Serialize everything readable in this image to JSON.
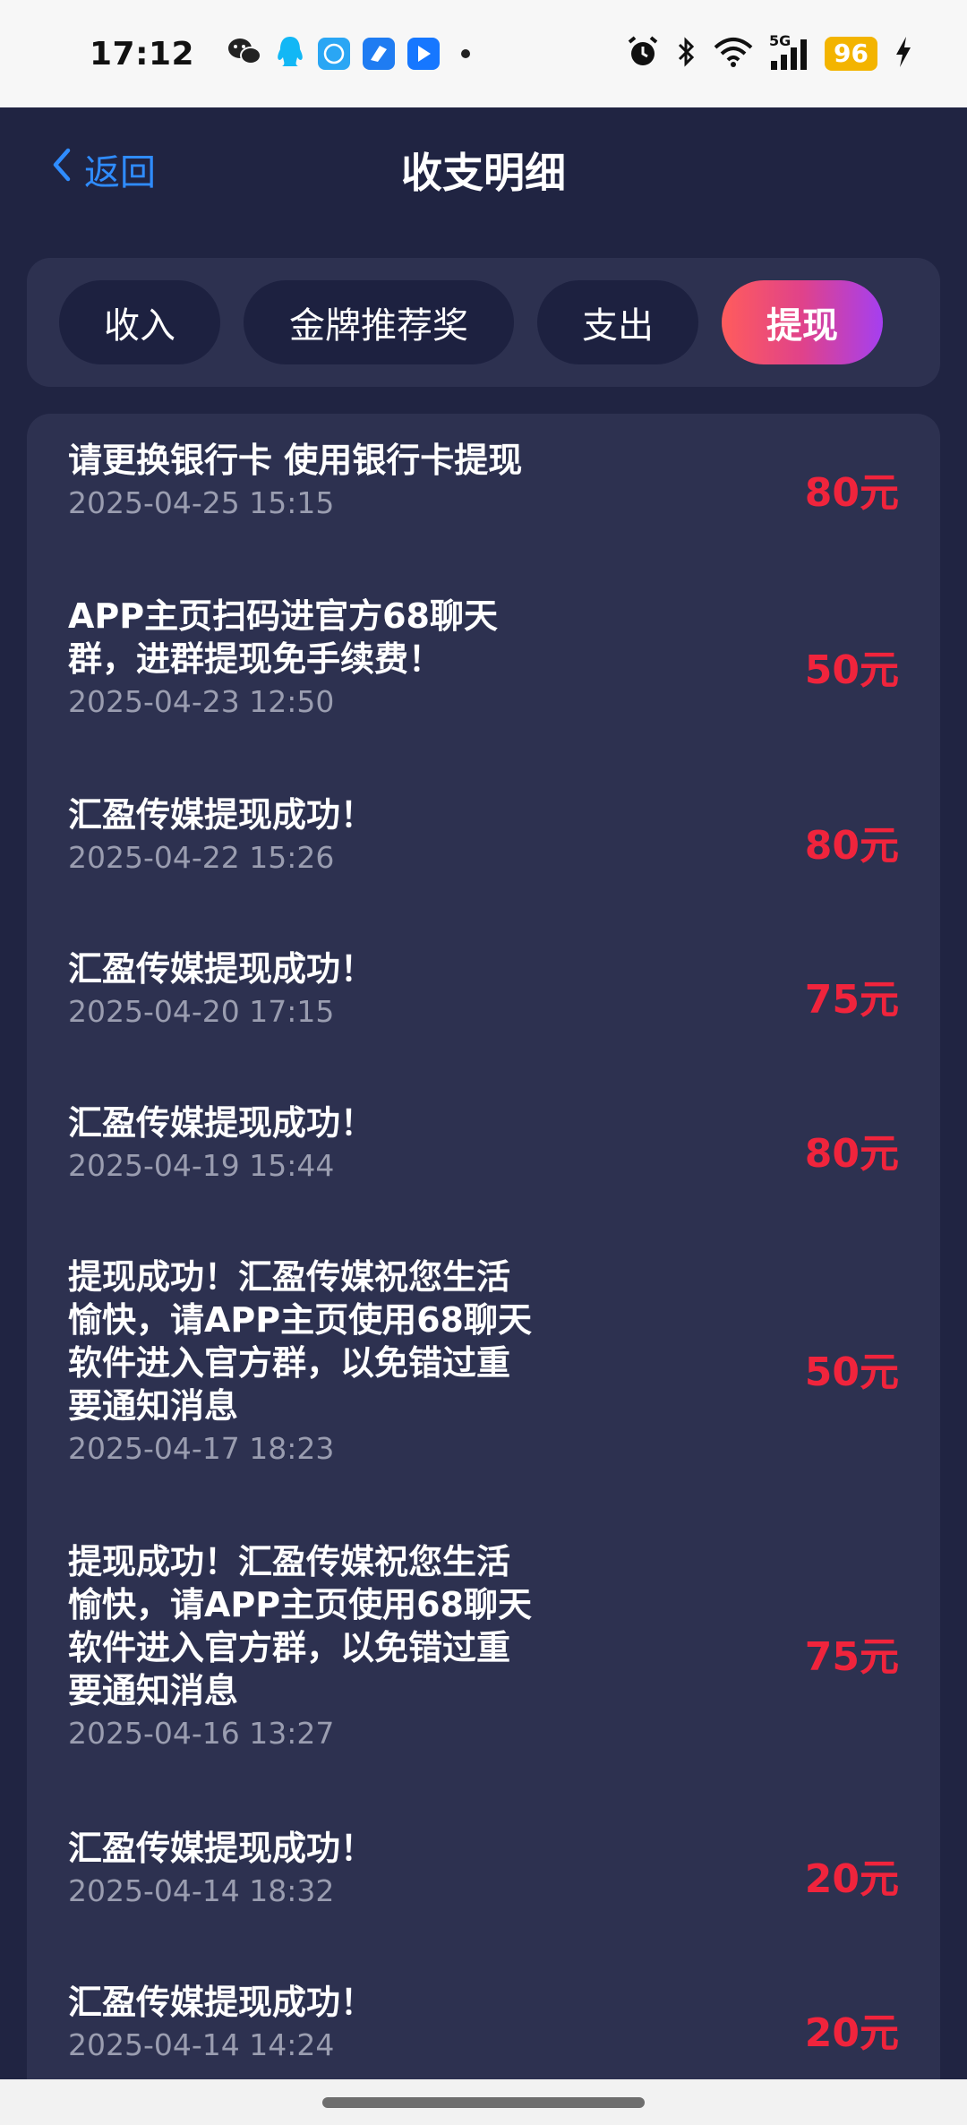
{
  "status_bar": {
    "time": "17:12",
    "battery": "96",
    "network": "5G",
    "icons": [
      "wechat-icon",
      "qq-icon",
      "message-app-icon",
      "feishu-icon",
      "flag-app-icon",
      "alarm-icon",
      "bluetooth-icon",
      "wifi-icon",
      "signal-icon",
      "charging-icon"
    ],
    "colors": {
      "battery_bg": "#f3b400"
    }
  },
  "header": {
    "back_label": "返回",
    "title": "收支明细"
  },
  "tabs": [
    {
      "label": "收入",
      "active": false
    },
    {
      "label": "金牌推荐奖",
      "active": false
    },
    {
      "label": "支出",
      "active": false
    },
    {
      "label": "提现",
      "active": true
    }
  ],
  "records": [
    {
      "title": "请更换银行卡 使用银行卡提现",
      "date": "2025-04-25 15:15",
      "amount": "80元"
    },
    {
      "title": "APP主页扫码进官方68聊天\n群，进群提现免手续费！",
      "date": "2025-04-23 12:50",
      "amount": "50元"
    },
    {
      "title": "汇盈传媒提现成功！",
      "date": "2025-04-22 15:26",
      "amount": "80元"
    },
    {
      "title": "汇盈传媒提现成功！",
      "date": "2025-04-20 17:15",
      "amount": "75元"
    },
    {
      "title": "汇盈传媒提现成功！",
      "date": "2025-04-19 15:44",
      "amount": "80元"
    },
    {
      "title": "提现成功！汇盈传媒祝您生活\n愉快，请APP主页使用68聊天\n软件进入官方群，以免错过重\n要通知消息",
      "date": "2025-04-17 18:23",
      "amount": "50元"
    },
    {
      "title": "提现成功！汇盈传媒祝您生活\n愉快，请APP主页使用68聊天\n软件进入官方群，以免错过重\n要通知消息",
      "date": "2025-04-16 13:27",
      "amount": "75元"
    },
    {
      "title": "汇盈传媒提现成功！",
      "date": "2025-04-14 18:32",
      "amount": "20元"
    },
    {
      "title": "汇盈传媒提现成功！",
      "date": "2025-04-14 14:24",
      "amount": "20元"
    }
  ],
  "colors": {
    "background": "#202442",
    "panel": "#2d3150",
    "amount": "#f0243c",
    "back_link": "#2f8cff",
    "active_tab_gradient": [
      "#ff5c5c",
      "#a53ff0"
    ]
  }
}
